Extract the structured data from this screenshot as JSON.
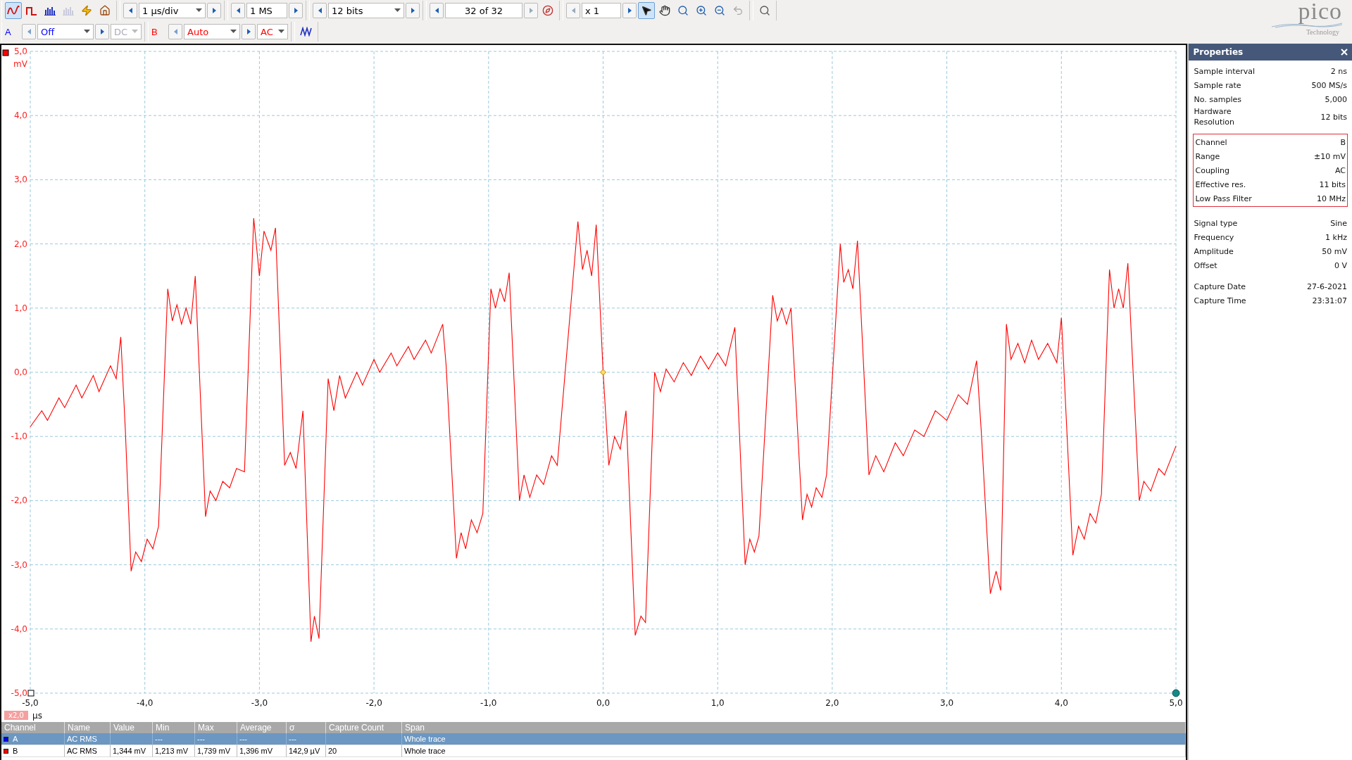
{
  "toolbar": {
    "modes": [
      {
        "kind": "scope",
        "selected": true,
        "disabled": false
      },
      {
        "kind": "persistence",
        "selected": false,
        "disabled": false
      },
      {
        "kind": "spectrum",
        "selected": false,
        "disabled": false
      },
      {
        "kind": "spectrum",
        "selected": false,
        "disabled": true
      }
    ],
    "steppers": [
      {
        "value": "1 µs/div",
        "dropdown": true
      },
      {
        "value": "1 MS",
        "dropdown": false
      },
      {
        "value": "12 bits",
        "dropdown": true
      }
    ],
    "buffer": {
      "value": "32 of 32"
    },
    "zoom": {
      "value": "x 1"
    },
    "tools": [
      {
        "kind": "pointer",
        "selected": true
      },
      {
        "kind": "hand",
        "selected": false
      },
      {
        "kind": "zoom",
        "selected": false
      },
      {
        "kind": "zoom-in",
        "selected": false
      },
      {
        "kind": "zoom-out",
        "selected": false
      },
      {
        "kind": "undo",
        "selected": false
      }
    ]
  },
  "channels": [
    {
      "label": "A",
      "color": "#0000ff",
      "range": "Off",
      "coupling": "DC",
      "coupling_disabled": true
    },
    {
      "label": "B",
      "color": "#ff0000",
      "range": "Auto",
      "coupling": "AC",
      "coupling_disabled": false
    }
  ],
  "logo": {
    "word": "pico",
    "subtitle": "Technology"
  },
  "scope": {
    "zoom_badge": "x2,0",
    "chart_data": {
      "type": "line",
      "grid": true,
      "xlabel": "µs",
      "ylabel": "mV",
      "xlim": [
        -5,
        5
      ],
      "ylim": [
        -5,
        5
      ],
      "xticks": [
        {
          "value": -5,
          "label": "-5,0"
        },
        {
          "value": -4,
          "label": "-4,0"
        },
        {
          "value": -3,
          "label": "-3,0"
        },
        {
          "value": -2,
          "label": "-2,0"
        },
        {
          "value": -1,
          "label": "-1,0"
        },
        {
          "value": 0,
          "label": "0,0"
        },
        {
          "value": 1,
          "label": "1,0"
        },
        {
          "value": 2,
          "label": "2,0"
        },
        {
          "value": 3,
          "label": "3,0"
        },
        {
          "value": 4,
          "label": "4,0"
        },
        {
          "value": 5,
          "label": "5,0"
        }
      ],
      "yticks": [
        {
          "value": 5,
          "label": "5,0"
        },
        {
          "value": 4,
          "label": "4,0"
        },
        {
          "value": 3,
          "label": "3,0"
        },
        {
          "value": 2,
          "label": "2,0"
        },
        {
          "value": 1,
          "label": "1,0"
        },
        {
          "value": 0,
          "label": "0,0"
        },
        {
          "value": -1,
          "label": "-1,0"
        },
        {
          "value": -2,
          "label": "-2,0"
        },
        {
          "value": -3,
          "label": "-3,0"
        },
        {
          "value": -4,
          "label": "-4,0"
        },
        {
          "value": -5,
          "label": "-5,0"
        }
      ],
      "x": [
        -5.0,
        -4.9,
        -4.85,
        -4.75,
        -4.7,
        -4.6,
        -4.55,
        -4.45,
        -4.4,
        -4.3,
        -4.25,
        -4.21,
        -4.17,
        -4.12,
        -4.08,
        -4.03,
        -3.98,
        -3.93,
        -3.88,
        -3.8,
        -3.76,
        -3.72,
        -3.68,
        -3.64,
        -3.6,
        -3.56,
        -3.47,
        -3.43,
        -3.38,
        -3.32,
        -3.26,
        -3.2,
        -3.13,
        -3.05,
        -3.0,
        -2.96,
        -2.9,
        -2.86,
        -2.78,
        -2.73,
        -2.68,
        -2.62,
        -2.55,
        -2.52,
        -2.48,
        -2.4,
        -2.35,
        -2.3,
        -2.25,
        -2.15,
        -2.1,
        -2.0,
        -1.95,
        -1.85,
        -1.8,
        -1.7,
        -1.65,
        -1.55,
        -1.5,
        -1.4,
        -1.37,
        -1.28,
        -1.24,
        -1.2,
        -1.15,
        -1.1,
        -1.05,
        -0.98,
        -0.94,
        -0.9,
        -0.86,
        -0.82,
        -0.73,
        -0.69,
        -0.64,
        -0.58,
        -0.52,
        -0.45,
        -0.4,
        -0.22,
        -0.18,
        -0.14,
        -0.1,
        -0.06,
        0.0,
        0.05,
        0.1,
        0.15,
        0.2,
        0.28,
        0.33,
        0.37,
        0.45,
        0.5,
        0.55,
        0.62,
        0.7,
        0.77,
        0.85,
        0.92,
        1.0,
        1.07,
        1.15,
        1.24,
        1.28,
        1.32,
        1.36,
        1.48,
        1.52,
        1.56,
        1.6,
        1.64,
        1.74,
        1.78,
        1.82,
        1.86,
        1.91,
        1.95,
        2.07,
        2.1,
        2.14,
        2.18,
        2.22,
        2.32,
        2.38,
        2.45,
        2.55,
        2.62,
        2.72,
        2.8,
        2.9,
        3.0,
        3.1,
        3.18,
        3.26,
        3.3,
        3.38,
        3.43,
        3.47,
        3.52,
        3.56,
        3.62,
        3.68,
        3.74,
        3.8,
        3.88,
        3.96,
        4.0,
        4.1,
        4.15,
        4.2,
        4.25,
        4.3,
        4.35,
        4.42,
        4.46,
        4.5,
        4.54,
        4.58,
        4.68,
        4.72,
        4.78,
        4.85,
        4.9,
        5.0
      ],
      "series": [
        {
          "color": "#ff0000",
          "values": [
            -0.85,
            -0.6,
            -0.75,
            -0.4,
            -0.55,
            -0.2,
            -0.4,
            -0.05,
            -0.3,
            0.1,
            -0.1,
            0.55,
            -0.9,
            -3.1,
            -2.8,
            -2.95,
            -2.6,
            -2.75,
            -2.4,
            1.3,
            0.8,
            1.05,
            0.75,
            1.0,
            0.75,
            1.5,
            -2.25,
            -1.85,
            -2.0,
            -1.7,
            -1.8,
            -1.5,
            -1.55,
            2.4,
            1.5,
            2.2,
            1.9,
            2.25,
            -1.45,
            -1.25,
            -1.5,
            -0.6,
            -4.2,
            -3.8,
            -4.15,
            -0.1,
            -0.6,
            -0.05,
            -0.4,
            0.0,
            -0.2,
            0.2,
            0.0,
            0.3,
            0.1,
            0.4,
            0.2,
            0.5,
            0.3,
            0.75,
            0.1,
            -2.9,
            -2.5,
            -2.75,
            -2.3,
            -2.5,
            -2.2,
            1.3,
            1.0,
            1.3,
            1.1,
            1.55,
            -2.0,
            -1.6,
            -1.95,
            -1.6,
            -1.75,
            -1.3,
            -1.45,
            2.35,
            1.6,
            1.9,
            1.5,
            2.3,
            0.0,
            -1.45,
            -1.0,
            -1.2,
            -0.6,
            -4.1,
            -3.8,
            -3.9,
            0.0,
            -0.3,
            0.05,
            -0.15,
            0.15,
            -0.05,
            0.25,
            0.05,
            0.3,
            0.1,
            0.7,
            -3.0,
            -2.6,
            -2.8,
            -2.55,
            1.2,
            0.8,
            1.0,
            0.75,
            1.0,
            -2.3,
            -1.9,
            -2.1,
            -1.8,
            -1.95,
            -1.6,
            2.0,
            1.4,
            1.6,
            1.3,
            2.05,
            -1.6,
            -1.3,
            -1.55,
            -1.1,
            -1.3,
            -0.9,
            -1.0,
            -0.6,
            -0.75,
            -0.35,
            -0.5,
            0.18,
            -0.9,
            -3.45,
            -3.1,
            -3.4,
            0.75,
            0.2,
            0.45,
            0.15,
            0.5,
            0.2,
            0.45,
            0.15,
            0.85,
            -2.85,
            -2.4,
            -2.6,
            -2.2,
            -2.35,
            -1.9,
            1.6,
            1.0,
            1.3,
            1.0,
            1.7,
            -2.0,
            -1.7,
            -1.85,
            -1.5,
            -1.6,
            -1.15
          ]
        }
      ]
    }
  },
  "measurements": {
    "columns": [
      "Channel",
      "Name",
      "Value",
      "Min",
      "Max",
      "Average",
      "σ",
      "Capture Count",
      "Span"
    ],
    "rows": [
      {
        "color": "#0000ff",
        "selected": true,
        "cells": [
          "A",
          "AC RMS",
          null,
          "---",
          "---",
          "---",
          "---",
          null,
          "Whole trace"
        ]
      },
      {
        "color": "#ff0000",
        "selected": false,
        "cells": [
          "B",
          "AC RMS",
          "1,344 mV",
          "1,213 mV",
          "1,739 mV",
          "1,396 mV",
          "142,9 µV",
          "20",
          "Whole trace"
        ]
      }
    ]
  },
  "properties": {
    "title": "Properties",
    "groups": [
      {
        "highlighted": false,
        "rows": [
          {
            "label": "Sample interval",
            "value": "2 ns"
          },
          {
            "label": "Sample rate",
            "value": "500 MS/s"
          },
          {
            "label": "No. samples",
            "value": "5,000"
          },
          {
            "label": "Hardware Resolution",
            "value": "12 bits"
          }
        ]
      },
      {
        "highlighted": true,
        "rows": [
          {
            "label": "Channel",
            "value": "B"
          },
          {
            "label": "Range",
            "value": "±10 mV"
          },
          {
            "label": "Coupling",
            "value": "AC"
          },
          {
            "label": "Effective res.",
            "value": "11 bits"
          },
          {
            "label": "Low Pass Filter",
            "value": "10 MHz"
          }
        ]
      },
      {
        "highlighted": false,
        "rows": [
          {
            "label": "Signal type",
            "value": "Sine"
          },
          {
            "label": "Frequency",
            "value": "1 kHz"
          },
          {
            "label": "Amplitude",
            "value": "50 mV"
          },
          {
            "label": "Offset",
            "value": "0 V"
          }
        ]
      },
      {
        "highlighted": false,
        "rows": [
          {
            "label": "Capture Date",
            "value": "27-6-2021"
          },
          {
            "label": "Capture Time",
            "value": "23:31:07"
          }
        ]
      }
    ]
  }
}
